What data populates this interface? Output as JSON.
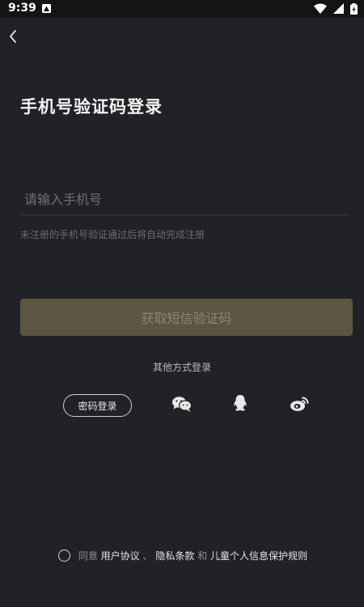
{
  "status_bar": {
    "time": "9:39",
    "icons": [
      "app-notification-icon",
      "wifi-icon",
      "signal-icon",
      "battery-charging-icon"
    ]
  },
  "nav": {
    "back_icon": "chevron-left-icon"
  },
  "title": "手机号验证码登录",
  "phone_input": {
    "value": "",
    "placeholder": "请输入手机号"
  },
  "hint": "未注册的手机号验证通过后将自动完成注册",
  "get_code_button": "获取短信验证码",
  "other_methods": {
    "label": "其他方式登录",
    "password_login": "密码登录",
    "icons": [
      "wechat-icon",
      "qq-icon",
      "weibo-icon"
    ]
  },
  "agreement": {
    "prefix": "同意",
    "user_agreement": "用户协议",
    "separator": "、",
    "privacy_policy": "隐私条款",
    "conjunction": "和",
    "child_privacy": "儿童个人信息保护规则"
  },
  "colors": {
    "background": "#212226",
    "status_bar": "#141416",
    "button_disabled_bg": "#5d5443",
    "button_disabled_text": "#8e8470"
  }
}
